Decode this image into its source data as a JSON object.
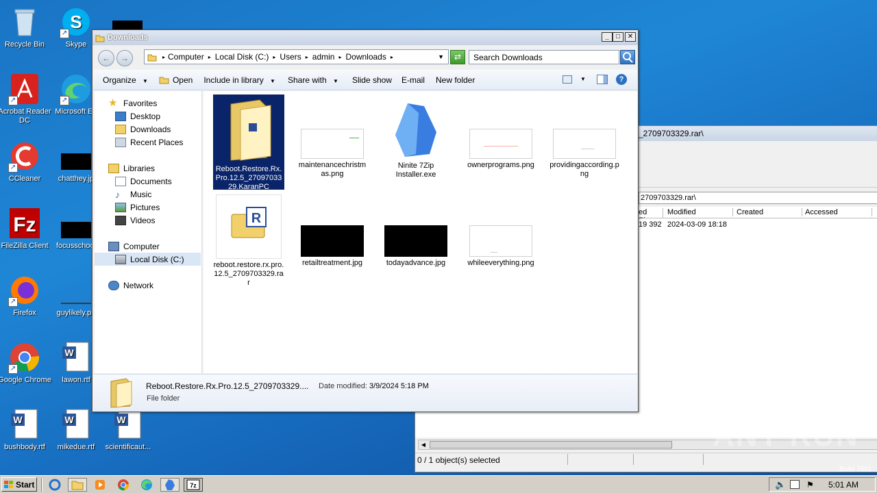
{
  "desktop": {
    "icons": [
      {
        "name": "recycle-bin",
        "label": "Recycle Bin"
      },
      {
        "name": "skype",
        "label": "Skype"
      },
      {
        "name": "acrobat",
        "label": "Acrobat Reader DC"
      },
      {
        "name": "edge",
        "label": "Microsoft Ed"
      },
      {
        "name": "ccleaner",
        "label": "CCleaner"
      },
      {
        "name": "chatthey",
        "label": "chatthey.jp"
      },
      {
        "name": "filezilla",
        "label": "FileZilla Client"
      },
      {
        "name": "focusschool",
        "label": "focusschool"
      },
      {
        "name": "firefox",
        "label": "Firefox"
      },
      {
        "name": "guylikely",
        "label": "guylikely.pn"
      },
      {
        "name": "chrome",
        "label": "Google Chrome"
      },
      {
        "name": "lawon",
        "label": "lawon.rtf"
      },
      {
        "name": "bushbody",
        "label": "bushbody.rtf"
      },
      {
        "name": "mikedue",
        "label": "mikedue.rtf"
      },
      {
        "name": "scientificaut",
        "label": "scientificaut..."
      }
    ]
  },
  "sevenzip": {
    "path_tail": "_2709703329.rar\\",
    "address_tail": "2709703329.rar\\",
    "columns": [
      "ed Size",
      "Modified",
      "Created",
      "Accessed"
    ],
    "row": {
      "size": "19 392",
      "modified": "2024-03-09 18:18"
    },
    "status": "0 / 1 object(s) selected",
    "build": "Build 7601"
  },
  "explorer": {
    "title": "Downloads",
    "breadcrumb": [
      "Computer",
      "Local Disk (C:)",
      "Users",
      "admin",
      "Downloads"
    ],
    "search_placeholder": "Search Downloads",
    "toolbar": {
      "organize": "Organize",
      "open": "Open",
      "include": "Include in library",
      "share": "Share with",
      "slideshow": "Slide show",
      "email": "E-mail",
      "newfolder": "New folder"
    },
    "nav": {
      "favorites": "Favorites",
      "desktop": "Desktop",
      "downloads": "Downloads",
      "recent": "Recent Places",
      "libraries": "Libraries",
      "documents": "Documents",
      "music": "Music",
      "pictures": "Pictures",
      "videos": "Videos",
      "computer": "Computer",
      "localdisk": "Local Disk (C:)",
      "network": "Network"
    },
    "files": [
      {
        "label": "Reboot.Restore.Rx.Pro.12.5_2709703329.KaranPC",
        "type": "folder"
      },
      {
        "label": "maintenancechristmas.png",
        "type": "png"
      },
      {
        "label": "Ninite 7Zip Installer.exe",
        "type": "exe"
      },
      {
        "label": "ownerprograms.png",
        "type": "png"
      },
      {
        "label": "providingaccording.png",
        "type": "png"
      },
      {
        "label": "reboot.restore.rx.pro.12.5_2709703329.rar",
        "type": "rar"
      },
      {
        "label": "retailtreatment.jpg",
        "type": "jpg"
      },
      {
        "label": "todayadvance.jpg",
        "type": "jpg"
      },
      {
        "label": "whileeverything.png",
        "type": "png"
      }
    ],
    "details": {
      "name": "Reboot.Restore.Rx.Pro.12.5_2709703329....",
      "date_label": "Date modified:",
      "date": "3/9/2024 5:18 PM",
      "kind": "File folder"
    }
  },
  "taskbar": {
    "start": "Start",
    "clock": "5:01 AM"
  },
  "watermark": "ANY RUN"
}
